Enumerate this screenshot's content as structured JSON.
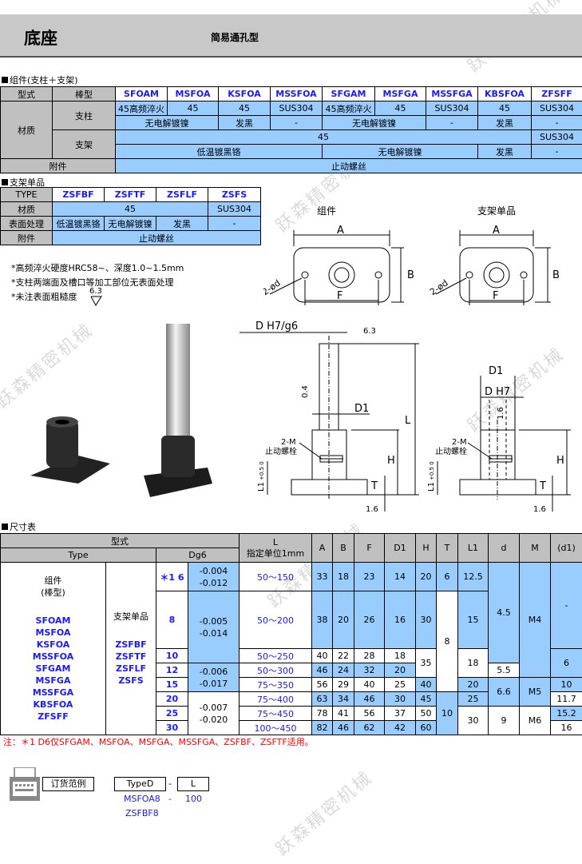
{
  "header": {
    "title": "底座",
    "subtitle": "简易通孔型"
  },
  "watermark": "跃森精密机械",
  "assembly": {
    "section": "组件(支柱＋支架)",
    "h_type": "型式",
    "h_rod": "棒型",
    "types": [
      "SFOAM",
      "MSFOA",
      "KSFOA",
      "MSSFOA",
      "SFGAM",
      "MSFGA",
      "MSSFGA",
      "KBSFOA",
      "ZFSFF"
    ],
    "material": "材质",
    "post": "支柱",
    "bracket": "支架",
    "accessory": "附件",
    "post_mat": [
      "45高频淬火",
      "45",
      "45",
      "SUS304",
      "45高频淬火",
      "45",
      "SUS304",
      "45",
      "SUS304"
    ],
    "post_surf": [
      "无电解镀镍",
      "发黑",
      "-",
      "无电解镀镍",
      "-",
      "发黑",
      "-"
    ],
    "br_mat": [
      "45",
      "SUS304"
    ],
    "br_surf": [
      "低温镀黑铬",
      "无电解镀镍",
      "发黑",
      "-"
    ],
    "acc_val": "止动螺丝"
  },
  "bracket_single": {
    "section": "支架单品",
    "h_type": "TYPE",
    "types": [
      "ZSFBF",
      "ZSFTF",
      "ZSFLF",
      "ZSFS"
    ],
    "material": "材质",
    "mat": [
      "45",
      "SUS304"
    ],
    "surface": "表面处理",
    "surf": [
      "低温镀黑铬",
      "无电解镀镍",
      "发黑",
      "-"
    ],
    "accessory": "附件",
    "acc_val": "止动螺丝"
  },
  "notes": [
    "*高频淬火硬度HRC58~、深度1.0~1.5mm",
    "*支柱两端面及槽口等加工部位无表面处理",
    "*未注表面粗糙度"
  ],
  "roughness": "6.3",
  "drawing": {
    "label_assembly": "组件",
    "label_bracket": "支架单品",
    "A": "A",
    "B": "B",
    "F": "F",
    "d": "2-ød",
    "DH7g6": "D H7/g6",
    "DH7": "D H7",
    "D1": "D1",
    "L": "L",
    "H": "H",
    "T": "T",
    "L1": "L1",
    "tol": "+0.5 0",
    "M": "2-M",
    "screw": "止动螺栓",
    "r63": "6.3",
    "r04": "0.4",
    "r16": "1.6"
  },
  "dims": {
    "section": "尺寸表",
    "h_xingshi": "型式",
    "h_type": "Type",
    "h_dg6": "Dg6",
    "h_L": "L",
    "h_L_sub": "指定单位1mm",
    "cols": [
      "A",
      "B",
      "F",
      "D1",
      "H",
      "T",
      "L1",
      "d",
      "M",
      "(d1)"
    ],
    "asm_label": "组件",
    "asm_sub": "(棒型)",
    "asm_types": [
      "SFOAM",
      "MSFOA",
      "KSFOA",
      "MSSFOA",
      "SFGAM",
      "MSFGA",
      "MSSFGA",
      "KBSFOA",
      "ZFSFF"
    ],
    "br_label": "支架单品",
    "br_types": [
      "ZSFBF",
      "ZSFTF",
      "ZSFLF",
      "ZSFS"
    ],
    "D": [
      "＊1 6",
      "8",
      "10",
      "12",
      "15",
      "20",
      "25",
      "30"
    ],
    "tol": [
      [
        "-0.004",
        "-0.012"
      ],
      [
        "-0.005",
        "-0.014"
      ],
      [
        "-0.006",
        "-0.017"
      ],
      [
        "-0.007",
        "-0.020"
      ]
    ],
    "L": [
      "50～150",
      "50～200",
      "50～250",
      "50～300",
      "75～350",
      "75～400",
      "75～450",
      "100～450"
    ],
    "A": [
      "33",
      "38",
      "40",
      "46",
      "56",
      "63",
      "78",
      "82"
    ],
    "B": [
      "18",
      "20",
      "22",
      "24",
      "29",
      "34",
      "41",
      "46"
    ],
    "F": [
      "23",
      "26",
      "28",
      "32",
      "40",
      "46",
      "56",
      "62"
    ],
    "D1": [
      "14",
      "16",
      "18",
      "20",
      "25",
      "30",
      "37",
      "42"
    ],
    "H": [
      "20",
      "30",
      "35",
      "40",
      "45",
      "50",
      "60"
    ],
    "T": [
      "6",
      "8",
      "10"
    ],
    "L1": [
      "12.5",
      "15",
      "18",
      "20",
      "25",
      "30"
    ],
    "d": [
      "4.5",
      "5.5",
      "6.6",
      "9"
    ],
    "M": [
      "M4",
      "M5",
      "M6"
    ],
    "d1": [
      "-",
      "6",
      "10",
      "11.7",
      "15.2",
      "16"
    ]
  },
  "footnote": "注：＊1 D6仅SFGAM、MSFOA、MSFGA、MSSFGA、ZSFBF、ZSFTF适用。",
  "order": {
    "label": "订货范例",
    "typeD": "TypeD",
    "dash": "-",
    "L": "L",
    "ex1": "MSFOA8",
    "ex_dash": "-",
    "ex_L": "100",
    "ex2": "ZSFBF8"
  },
  "colors": {
    "blue_cell": "#99ccff",
    "gray_cell": "#c0c0c0",
    "type_text": "#1a1aff",
    "note_red": "#ff0000"
  }
}
